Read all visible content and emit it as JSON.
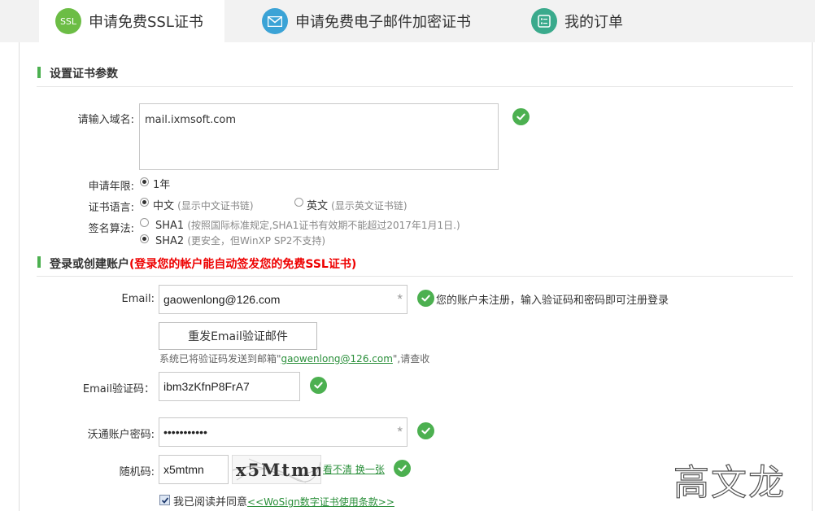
{
  "tabs": [
    {
      "label": "申请免费SSL证书",
      "icon_text": "SSL",
      "icon": "ssl-badge-icon",
      "color": "#6cbd45",
      "active": true
    },
    {
      "label": "申请免费电子邮件加密证书",
      "icon": "envelope-icon",
      "color": "#3ba3d6",
      "active": false
    },
    {
      "label": "我的订单",
      "icon": "list-icon",
      "color": "#3aaa8c",
      "active": false
    }
  ],
  "cert_section": {
    "title": "设置证书参数",
    "domain_label": "请输入域名:",
    "domain_value": "mail.ixmsoft.com",
    "term_label": "申请年限:",
    "term_option": "1年",
    "lang_label": "证书语言:",
    "lang_cn": "中文",
    "lang_cn_hint": "(显示中文证书链)",
    "lang_en": "英文",
    "lang_en_hint": "(显示英文证书链)",
    "algo_label": "签名算法:",
    "sha1": "SHA1",
    "sha1_hint": "(按照国际标准规定,SHA1证书有效期不能超过2017年1月1日.)",
    "sha2": "SHA2",
    "sha2_hint": "(更安全，但WinXP SP2不支持)"
  },
  "account_section": {
    "title": "登录或创建账户",
    "note": "(登录您的帐户能自动签发您的免费SSL证书)",
    "email_label": "Email:",
    "email_value": "gaowenlong@126.com",
    "email_status": "您的账户未注册，输入验证码和密码即可注册登录",
    "resend_button": "重发Email验证邮件",
    "sent_prefix": "系统已将验证码发送到邮箱\"",
    "sent_email": "gaowenlong@126.com",
    "sent_suffix": "\",请查收",
    "code_label": "Email验证码：",
    "code_value": "ibm3zKfnP8FrA7",
    "password_label": "沃通账户密码:",
    "password_value": "•••••••••••",
    "captcha_label": "随机码:",
    "captcha_value": "x5mtmn",
    "captcha_image_text": "x5Mtmn",
    "captcha_refresh": "看不清 换一张",
    "agree_text": "我已阅读并同意",
    "agree_link": "<<WoSign数字证书使用条款>>",
    "required_mark": "*"
  },
  "watermark": "高文龙"
}
